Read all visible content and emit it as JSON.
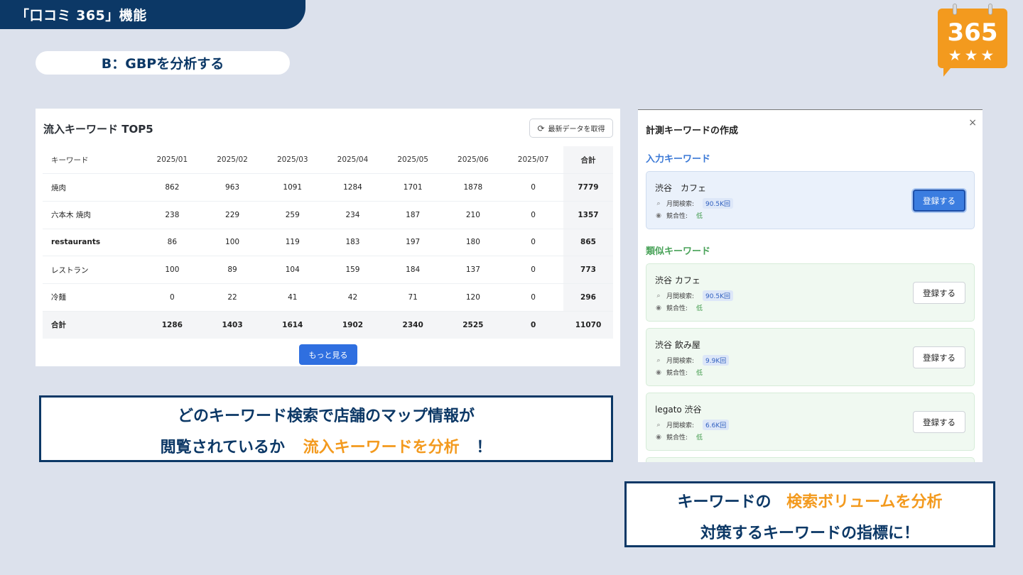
{
  "header": {
    "title": "「口コミ 365」機能"
  },
  "logo": {
    "number": "365",
    "stars": "★★★"
  },
  "section": {
    "label": "B：GBPを分析する"
  },
  "keyword_table": {
    "title": "流入キーワード TOP5",
    "refresh_label": "最新データを取得",
    "columns": [
      "キーワード",
      "2025/01",
      "2025/02",
      "2025/03",
      "2025/04",
      "2025/05",
      "2025/06",
      "2025/07",
      "合計"
    ],
    "rows": [
      [
        "焼肉",
        "862",
        "963",
        "1091",
        "1284",
        "1701",
        "1878",
        "0",
        "7779"
      ],
      [
        "六本木 焼肉",
        "238",
        "229",
        "259",
        "234",
        "187",
        "210",
        "0",
        "1357"
      ],
      [
        "restaurants",
        "86",
        "100",
        "119",
        "183",
        "197",
        "180",
        "0",
        "865"
      ],
      [
        "レストラン",
        "100",
        "89",
        "104",
        "159",
        "184",
        "137",
        "0",
        "773"
      ],
      [
        "冷麺",
        "0",
        "22",
        "41",
        "42",
        "71",
        "120",
        "0",
        "296"
      ]
    ],
    "total_row": [
      "合計",
      "1286",
      "1403",
      "1614",
      "1902",
      "2340",
      "2525",
      "0",
      "11070"
    ],
    "more_label": "もっと見る"
  },
  "caption_left": {
    "line1": "どのキーワード検索で店舗のマップ情報が",
    "line2_pre": "閲覧されているか",
    "line2_highlight": "流入キーワードを分析",
    "line2_post": "！"
  },
  "keyword_panel": {
    "title": "計測キーワードの作成",
    "close": "×",
    "input_section": "入力キーワード",
    "similar_section": "類似キーワード",
    "monthly_label": "月間検索:",
    "competition_label": "競合性:",
    "register_label": "登録する",
    "input_card": {
      "name": "渋谷　カフェ",
      "volume": "90.5K回",
      "competition": "低"
    },
    "similar_cards": [
      {
        "name": "渋谷 カフェ",
        "volume": "90.5K回",
        "competition": "低"
      },
      {
        "name": "渋谷 飲み屋",
        "volume": "9.9K回",
        "competition": "低"
      },
      {
        "name": "legato 渋谷",
        "volume": "6.6K回",
        "competition": "低"
      }
    ]
  },
  "caption_right": {
    "line1_pre": "キーワードの",
    "line1_highlight": "検索ボリュームを分析",
    "line2": "対策するキーワードの指標に！"
  },
  "colors": {
    "navy": "#0c3866",
    "orange": "#f39a1e",
    "primary_blue": "#2f6fe0",
    "background": "#dce1ec"
  }
}
